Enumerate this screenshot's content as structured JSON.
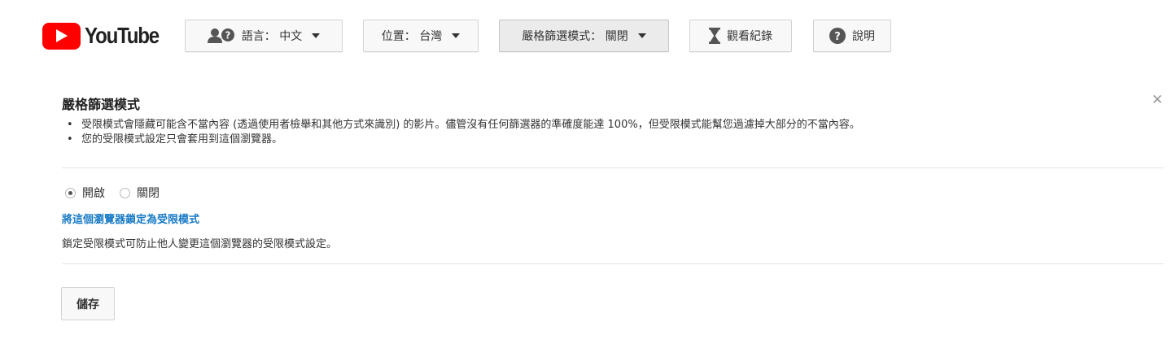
{
  "logo": {
    "wordmark": "YouTube"
  },
  "topbar": {
    "language": {
      "label": "語言： 中文",
      "icon": "language-icon"
    },
    "location": {
      "label": "位置： 台灣"
    },
    "restricted": {
      "label": "嚴格篩選模式： 關閉"
    },
    "history": {
      "label": "觀看紀錄",
      "icon": "hourglass-icon"
    },
    "help": {
      "label": "說明",
      "icon": "help-icon"
    }
  },
  "panel": {
    "title": "嚴格篩選模式",
    "close_icon": "close-icon",
    "bullets": [
      "受限模式會隱藏可能含不當內容 (透過使用者檢舉和其他方式來識別) 的影片。儘管沒有任何篩選器的準確度能達 100%，但受限模式能幫您過濾掉大部分的不當內容。",
      "您的受限模式設定只會套用到這個瀏覽器。"
    ],
    "options": [
      {
        "label": "開啟",
        "selected": true
      },
      {
        "label": "關閉",
        "selected": false
      }
    ],
    "lock_link": "將這個瀏覽器鎖定為受限模式",
    "lock_description": "鎖定受限模式可防止他人變更這個瀏覽器的受限模式設定。",
    "save_label": "儲存"
  },
  "colors": {
    "brand_red": "#ff0000",
    "link_blue": "#167ac6",
    "button_bg": "#f8f8f8",
    "active_button_bg": "#ebebeb"
  }
}
